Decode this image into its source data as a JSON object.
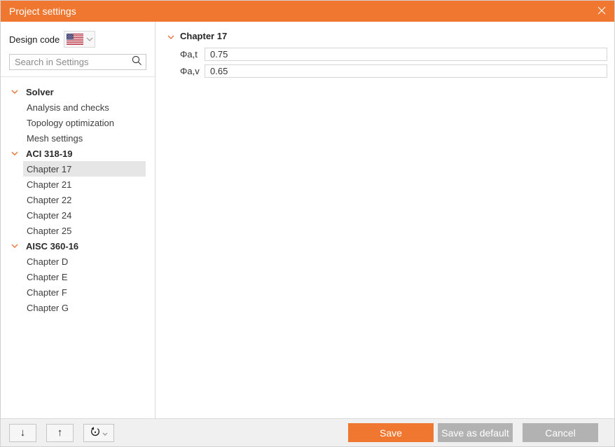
{
  "window": {
    "title": "Project settings"
  },
  "sidebar": {
    "design_code_label": "Design code",
    "search": {
      "placeholder": "Search in Settings"
    },
    "tree": [
      {
        "label": "Solver",
        "type": "group"
      },
      {
        "label": "Analysis and checks",
        "type": "item"
      },
      {
        "label": "Topology optimization",
        "type": "item"
      },
      {
        "label": "Mesh settings",
        "type": "item"
      },
      {
        "label": "ACI 318-19",
        "type": "group"
      },
      {
        "label": "Chapter 17",
        "type": "item",
        "selected": true
      },
      {
        "label": "Chapter 21",
        "type": "item"
      },
      {
        "label": "Chapter 22",
        "type": "item"
      },
      {
        "label": "Chapter 24",
        "type": "item"
      },
      {
        "label": "Chapter 25",
        "type": "item"
      },
      {
        "label": "AISC 360-16",
        "type": "group"
      },
      {
        "label": "Chapter D",
        "type": "item"
      },
      {
        "label": "Chapter E",
        "type": "item"
      },
      {
        "label": "Chapter F",
        "type": "item"
      },
      {
        "label": "Chapter G",
        "type": "item"
      }
    ]
  },
  "content": {
    "section_title": "Chapter 17",
    "fields": [
      {
        "label": "Φa,t",
        "value": "0.75"
      },
      {
        "label": "Φa,v",
        "value": "0.65"
      }
    ]
  },
  "footer": {
    "save_label": "Save",
    "save_default_label": "Save as default",
    "cancel_label": "Cancel"
  },
  "icons": {
    "titlebar_close": "close-icon",
    "flag": "us-flag-icon",
    "search": "search-icon",
    "tree_expander": "chevron-down-icon",
    "nav": [
      "arrow-down-icon",
      "arrow-up-icon",
      "reset-icon"
    ]
  },
  "colors": {
    "accent_orange": "#f0772f",
    "selected_row": "#e6e6e6",
    "gray_button": "#b2b2b2",
    "footer_bg": "#f0f0f0"
  }
}
